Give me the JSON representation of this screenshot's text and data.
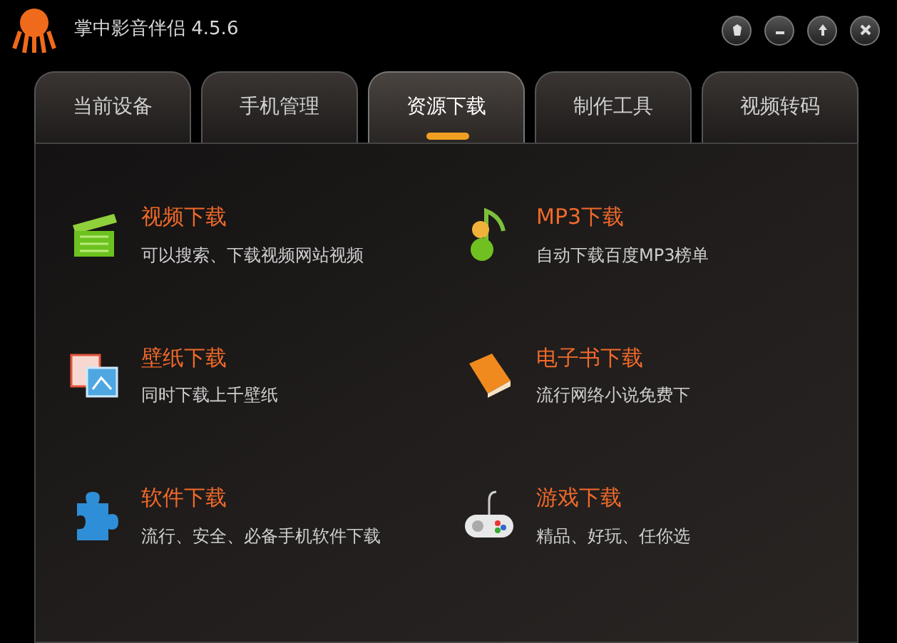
{
  "window": {
    "title": "掌中影音伴侣 4.5.6"
  },
  "tabs": [
    {
      "label": "当前设备",
      "selected": false
    },
    {
      "label": "手机管理",
      "selected": false
    },
    {
      "label": "资源下载",
      "selected": true
    },
    {
      "label": "制作工具",
      "selected": false
    },
    {
      "label": "视频转码",
      "selected": false
    }
  ],
  "items": [
    {
      "kind": "video",
      "title": "视频下载",
      "description": "可以搜索、下载视频网站视频"
    },
    {
      "kind": "music",
      "title": "MP3下载",
      "description": "自动下载百度MP3榜单"
    },
    {
      "kind": "wallpaper",
      "title": "壁纸下载",
      "description": "同时下载上千壁纸"
    },
    {
      "kind": "ebook",
      "title": "电子书下载",
      "description": "流行网络小说免费下"
    },
    {
      "kind": "software",
      "title": "软件下载",
      "description": "流行、安全、必备手机软件下载"
    },
    {
      "kind": "game",
      "title": "游戏下载",
      "description": "精品、好玩、任你选"
    }
  ]
}
